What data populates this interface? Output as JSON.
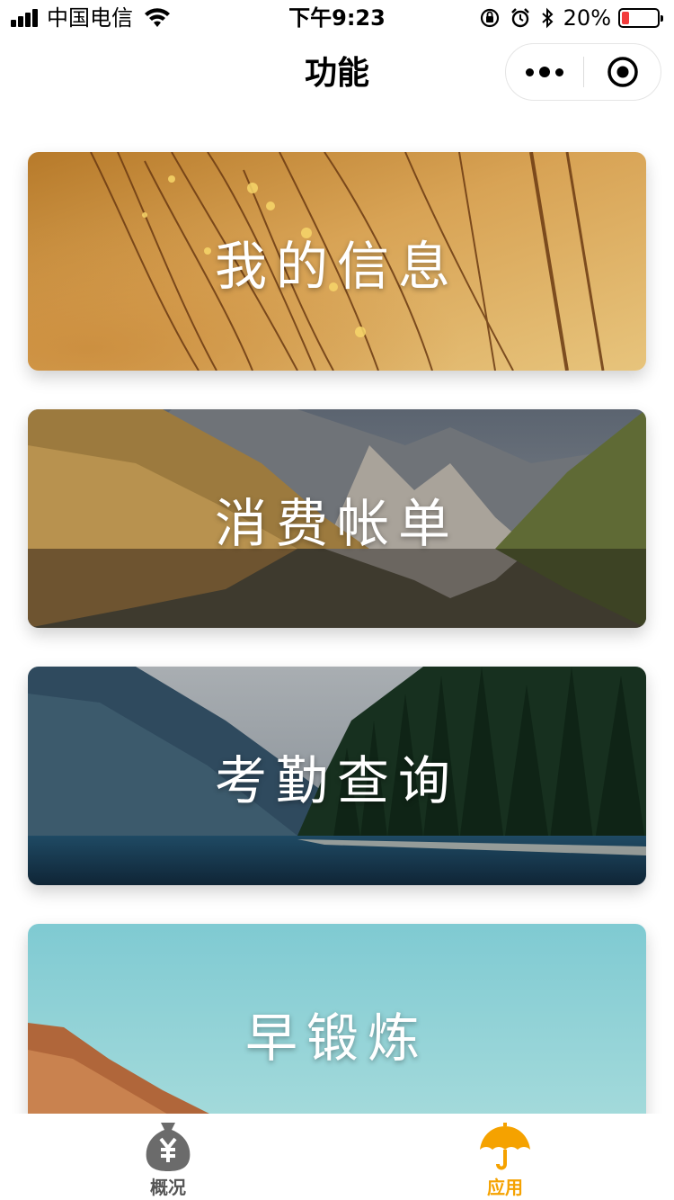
{
  "status_bar": {
    "carrier": "中国电信",
    "time": "下午9:23",
    "battery_percent": "20%",
    "battery_level": 0.2,
    "battery_color": "#f23c3c",
    "icons": [
      "signal-icon",
      "wifi-icon",
      "orientation-lock-icon",
      "alarm-icon",
      "bluetooth-icon",
      "battery-icon"
    ]
  },
  "nav": {
    "title": "功能",
    "capsule": {
      "more_icon": "more-dots-icon",
      "close_icon": "target-close-icon"
    }
  },
  "cards": [
    {
      "label": "我的信息",
      "scene": "golden-grass"
    },
    {
      "label": "消费帐单",
      "scene": "mountain-lake-reflection"
    },
    {
      "label": "考勤查询",
      "scene": "forest-lake"
    },
    {
      "label": "早锻炼",
      "scene": "sky-cliff"
    }
  ],
  "tab_bar": {
    "items": [
      {
        "label": "概况",
        "icon": "money-bag-icon",
        "active": false
      },
      {
        "label": "应用",
        "icon": "umbrella-icon",
        "active": true
      }
    ],
    "active_color": "#f5a200",
    "inactive_color": "#555555"
  }
}
